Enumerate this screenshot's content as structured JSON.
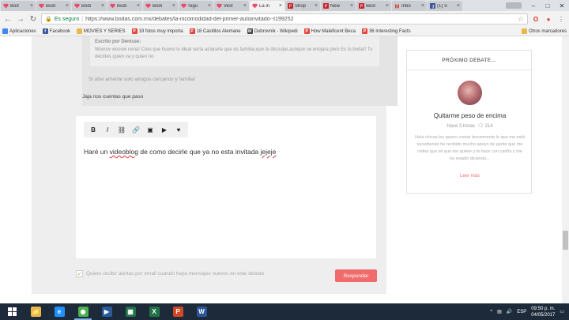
{
  "browser": {
    "tabs": [
      {
        "label": "Bod",
        "icon": "heart-icon",
        "active": false
      },
      {
        "label": "Bodi",
        "icon": "heart-icon",
        "active": false
      },
      {
        "label": "Bodi",
        "icon": "heart-icon",
        "active": false
      },
      {
        "label": "Bodi",
        "icon": "heart-icon",
        "active": false
      },
      {
        "label": "Bodi",
        "icon": "heart-icon",
        "active": false
      },
      {
        "label": "Sigu",
        "icon": "heart-icon",
        "active": false
      },
      {
        "label": "Vest",
        "icon": "heart-icon",
        "active": false
      },
      {
        "label": "La in",
        "icon": "heart-icon",
        "active": true
      },
      {
        "label": "Shop",
        "icon": "pinterest-icon",
        "active": false
      },
      {
        "label": "New",
        "icon": "pinterest-icon",
        "active": false
      },
      {
        "label": "Best",
        "icon": "pinterest-icon",
        "active": false
      },
      {
        "label": "Inbo",
        "icon": "gmail-icon",
        "active": false
      },
      {
        "label": "(1) S",
        "icon": "facebook-icon",
        "active": false
      }
    ],
    "security_label": "Es seguro",
    "url": "https://www.bodas.com.mx/debates/la-incomodidad-del-primer-autoinvitado--t199252",
    "bookmarks": [
      {
        "label": "Aplicaciones",
        "icon": "apps-icon",
        "color": "#4285f4"
      },
      {
        "label": "Facebook",
        "icon": "facebook-icon",
        "color": "#3b5998"
      },
      {
        "label": "MOVIES Y SERIES",
        "icon": "folder-icon",
        "color": "#e8b84a"
      },
      {
        "label": "19 fotos muy importa",
        "icon": "pinterest-icon",
        "color": "#e0443a"
      },
      {
        "label": "18 Castillos Alemane",
        "icon": "pinterest-icon",
        "color": "#e0443a"
      },
      {
        "label": "Dubrovnik - Wikipedi",
        "icon": "wikipedia-icon",
        "color": "#444444"
      },
      {
        "label": "How Maleficent Beca",
        "icon": "pinterest-icon",
        "color": "#e0443a"
      },
      {
        "label": "36 Interesting Facts",
        "icon": "pinterest-icon",
        "color": "#e0443a"
      }
    ],
    "other_bookmarks": "Otros marcadores"
  },
  "post": {
    "quote_header": "Escrito por Denisse:",
    "quote_text": "Wooow wooow nena! Creo que bueno lo ideal sería aclararle que es familiar,que te disculpe,aunque se enojara pero Es tu boda!! Tu decides quien va y quien no",
    "quote_reply": "Si obvi amente solo amigos cercanos y familia!",
    "after_quote": "Jaja nos cuentas que paso"
  },
  "editor": {
    "tools": [
      {
        "name": "bold-icon",
        "glyph": "B"
      },
      {
        "name": "italic-icon",
        "glyph": "I"
      },
      {
        "name": "unlink-icon",
        "glyph": "⛓"
      },
      {
        "name": "link-icon",
        "glyph": "🔗"
      },
      {
        "name": "image-icon",
        "glyph": "▣"
      },
      {
        "name": "video-icon",
        "glyph": "▶"
      },
      {
        "name": "heart-icon",
        "glyph": "♥"
      }
    ],
    "text_1": "Haré un ",
    "text_2": "videoblog",
    "text_3": " de como decirle que ya no esta invitada ",
    "text_4": "jejeje"
  },
  "form": {
    "alerts_label": "Quiero recibir alertas por email cuando haya mensajes nuevos en este debate",
    "alerts_checked": true,
    "submit_label": "Responder"
  },
  "next_debate": {
    "header": "PRÓXIMO DEBATE...",
    "title": "Quitarme peso de encima",
    "time": "Hace 3 horas",
    "comments": "214",
    "excerpt": "Hola chicas les quiero contar brevemente lo que me está sucediendo he recibido mucho apoyo de gente que me rodea que sé que me quiere y le hace con cariño y me ha estado diciendo...",
    "more_label": "Leer más"
  },
  "taskbar": {
    "apps": [
      {
        "name": "file-explorer-icon",
        "glyph": "📁",
        "color": "#e8b84a",
        "active": false
      },
      {
        "name": "internet-explorer-icon",
        "glyph": "e",
        "color": "#1e90ff",
        "active": false
      },
      {
        "name": "chrome-icon",
        "glyph": "◉",
        "color": "#4caf50",
        "active": true
      },
      {
        "name": "media-player-icon",
        "glyph": "▶",
        "color": "#2a5a9a",
        "active": false
      },
      {
        "name": "calculator-icon",
        "glyph": "▦",
        "color": "#217346",
        "active": false
      },
      {
        "name": "excel-icon",
        "glyph": "X",
        "color": "#217346",
        "active": false
      },
      {
        "name": "powerpoint-icon",
        "glyph": "P",
        "color": "#d24726",
        "active": false
      },
      {
        "name": "word-icon",
        "glyph": "W",
        "color": "#2b579a",
        "active": false
      }
    ],
    "language": "ESP",
    "time": "09:50 p. m.",
    "date": "04/05/2017"
  },
  "colors": {
    "accent": "#f06c6c",
    "taskbar": "#1d2a3a",
    "secure": "#0b8043"
  }
}
